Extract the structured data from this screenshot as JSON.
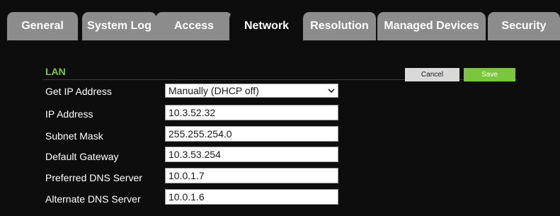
{
  "tabs": [
    {
      "label": "General"
    },
    {
      "label": "System Log"
    },
    {
      "label": "Access"
    },
    {
      "label": "Network"
    },
    {
      "label": "Resolution"
    },
    {
      "label": "Managed Devices"
    },
    {
      "label": "Security"
    }
  ],
  "active_tab": "Network",
  "section": {
    "title": "LAN",
    "cancel_label": "Cancel",
    "save_label": "Save"
  },
  "form": {
    "get_ip_label": "Get IP Address",
    "get_ip_value": "Manually (DHCP off)",
    "ip_label": "IP Address",
    "ip_value": "10.3.52.32",
    "subnet_label": "Subnet Mask",
    "subnet_value": "255.255.254.0",
    "gateway_label": "Default Gateway",
    "gateway_value": "10.3.53.254",
    "pref_dns_label": "Preferred DNS Server",
    "pref_dns_value": "10.0.1.7",
    "alt_dns_label": "Alternate DNS Server",
    "alt_dns_value": "10.0.1.6"
  },
  "colors": {
    "accent": "#7bc63c",
    "tab_inactive": "#8c8c8c",
    "background": "#0d0d0d"
  }
}
